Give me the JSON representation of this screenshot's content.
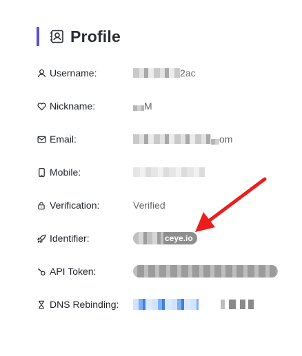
{
  "header": {
    "title": "Profile",
    "icon": "profile-card-icon",
    "accent_color": "#5b4fcf"
  },
  "fields": [
    {
      "key": "username",
      "icon": "user-icon",
      "label": "Username:",
      "value_visible": "2ac"
    },
    {
      "key": "nickname",
      "icon": "heart-icon",
      "label": "Nickname:",
      "value_visible": "M"
    },
    {
      "key": "email",
      "icon": "mail-icon",
      "label": "Email:",
      "value_visible": "om"
    },
    {
      "key": "mobile",
      "icon": "phone-icon",
      "label": "Mobile:",
      "value_visible": ""
    },
    {
      "key": "verification",
      "icon": "lock-icon",
      "label": "Verification:",
      "value_visible": "Verified"
    },
    {
      "key": "identifier",
      "icon": "rocket-icon",
      "label": "Identifier:",
      "value_visible": "ceye.io"
    },
    {
      "key": "api_token",
      "icon": "key-icon",
      "label": "API Token:",
      "value_visible": ""
    },
    {
      "key": "dns_rebinding",
      "icon": "hourglass-icon",
      "label": "DNS Rebinding:",
      "value_visible": ""
    }
  ],
  "annotation": {
    "arrow_color": "#ee1d1d"
  }
}
